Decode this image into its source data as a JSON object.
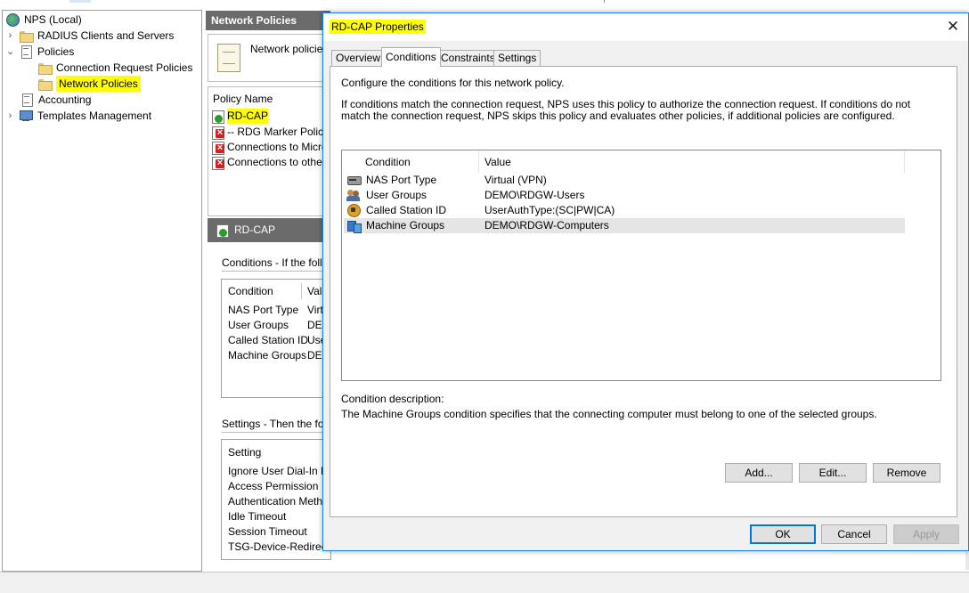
{
  "tree": {
    "root": "NPS (Local)",
    "items": [
      {
        "label": "RADIUS Clients and Servers"
      },
      {
        "label": "Policies"
      },
      {
        "label": "Connection Request Policies"
      },
      {
        "label": "Network Policies"
      },
      {
        "label": "Accounting"
      },
      {
        "label": "Templates Management"
      }
    ]
  },
  "results": {
    "title": "Network Policies",
    "header_text": "Network policies",
    "column_policy_name": "Policy Name",
    "policies": [
      {
        "name": "RD-CAP",
        "enabled": true
      },
      {
        "name": "-- RDG Marker Policy {",
        "enabled": false
      },
      {
        "name": "Connections to Microso",
        "enabled": false
      },
      {
        "name": "Connections to other a",
        "enabled": false
      }
    ],
    "detail": {
      "title": "RD-CAP",
      "conditions_label": "Conditions - If the follow",
      "conditions_col_condition": "Condition",
      "conditions_col_value": "Valu",
      "conditions": [
        {
          "name": "NAS Port Type",
          "value": "Virtu"
        },
        {
          "name": "User Groups",
          "value": "DEI"
        },
        {
          "name": "Called Station ID",
          "value": "Use"
        },
        {
          "name": "Machine Groups",
          "value": "DEI"
        }
      ],
      "settings_label": "Settings - Then the follo",
      "settings_col": "Setting",
      "settings": [
        "Ignore User Dial-In Pro",
        "Access Permission",
        "Authentication Method",
        "Idle Timeout",
        "Session Timeout",
        "TSG-Device-Redirection"
      ]
    }
  },
  "dialog": {
    "title": "RD-CAP Properties",
    "close_symbol": "✕",
    "tabs": [
      "Overview",
      "Conditions",
      "Constraints",
      "Settings"
    ],
    "active_tab": "Conditions",
    "intro": "Configure the conditions for this network policy.",
    "description": "If conditions match the connection request, NPS uses this policy to authorize the connection request. If conditions do not match the connection request, NPS skips this policy and evaluates other policies, if additional policies are configured.",
    "columns": {
      "condition": "Condition",
      "value": "Value"
    },
    "conditions": [
      {
        "icon": "nas-port-icon",
        "name": "NAS Port Type",
        "value": "Virtual (VPN)"
      },
      {
        "icon": "user-groups-icon",
        "name": "User Groups",
        "value": "DEMO\\RDGW-Users"
      },
      {
        "icon": "called-station-icon",
        "name": "Called Station ID",
        "value": "UserAuthType:(SC|PW|CA)"
      },
      {
        "icon": "machine-groups-icon",
        "name": "Machine Groups",
        "value": "DEMO\\RDGW-Computers"
      }
    ],
    "selected_condition": "Machine Groups",
    "condition_description_label": "Condition description:",
    "condition_description": "The Machine Groups condition specifies that the connecting computer must belong to one of the selected groups.",
    "buttons": {
      "add": "Add...",
      "edit": "Edit...",
      "remove": "Remove",
      "ok": "OK",
      "cancel": "Cancel",
      "apply": "Apply"
    }
  },
  "colors": {
    "highlight": "#ffff00",
    "accent": "#0078d7",
    "header_gray": "#6b6b6b"
  }
}
